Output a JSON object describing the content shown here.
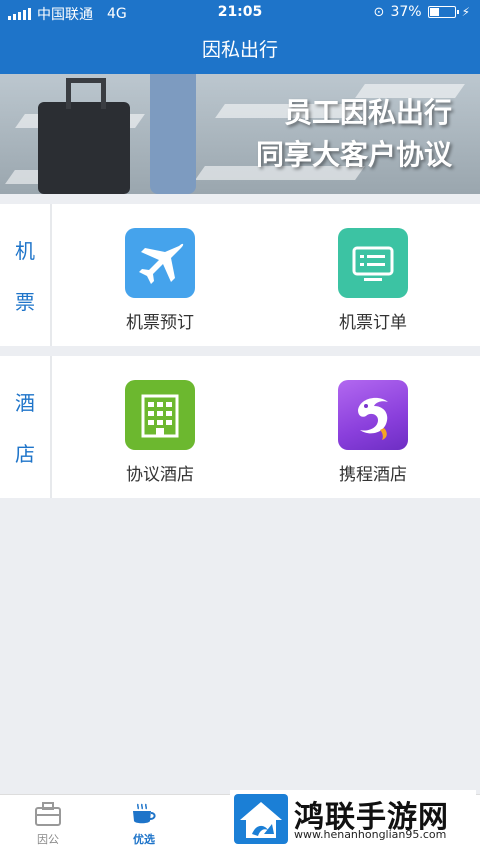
{
  "status_bar": {
    "carrier": "中国联通",
    "network": "4G",
    "time": "21:05",
    "battery": "37%",
    "battery_level": 0.37
  },
  "nav": {
    "title": "因私出行"
  },
  "banner": {
    "line1": "员工因私出行",
    "line2": "同享大客户协议"
  },
  "sections": [
    {
      "label_chars": [
        "机",
        "票"
      ],
      "tiles": [
        {
          "label": "机票预订",
          "icon": "airplane-icon",
          "color": "#45a3ec"
        },
        {
          "label": "机票订单",
          "icon": "order-list-icon",
          "color": "#3cc3a3"
        }
      ]
    },
    {
      "label_chars": [
        "酒",
        "店"
      ],
      "tiles": [
        {
          "label": "协议酒店",
          "icon": "hotel-building-icon",
          "color": "#6cb82f"
        },
        {
          "label": "携程酒店",
          "icon": "ctrip-dolphin-icon",
          "color": "#9b4fe6"
        }
      ]
    }
  ],
  "tabbar": {
    "tabs": [
      {
        "label": "因公",
        "icon": "briefcase-icon",
        "active": false
      },
      {
        "label": "优选",
        "icon": "coffee-cup-icon",
        "active": true
      }
    ]
  },
  "watermark": {
    "title": "鸿联手游网",
    "url": "www.henanhonglian95.com"
  },
  "colors": {
    "primary": "#1e74c9",
    "background": "#eceef2"
  }
}
